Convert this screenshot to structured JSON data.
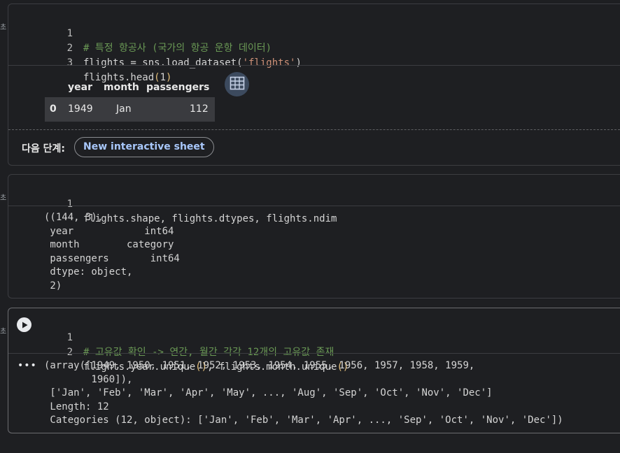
{
  "gutter_glyph": "초",
  "cell1": {
    "lines": [
      {
        "n": "1",
        "comment": "# 특정 항공사 (국가의 항공 운항 데이터)"
      },
      {
        "n": "2",
        "pre": "flights = sns.load_dataset(",
        "str": "'flights'",
        "post": ")"
      },
      {
        "n": "3",
        "pre": "flights.head",
        "lp": "(",
        "arg": "1",
        "rp": ")"
      }
    ],
    "df": {
      "columns": [
        "year",
        "month",
        "passengers"
      ],
      "rows": [
        {
          "index": "0",
          "year": "1949",
          "month": "Jan",
          "passengers": "112"
        }
      ]
    },
    "next_steps_label": "다음 단계:",
    "new_sheet_button": "New interactive sheet"
  },
  "cell2": {
    "lines": [
      {
        "n": "1",
        "code": "flights.shape, flights.dtypes, flights.ndim"
      }
    ],
    "output": "((144, 3),\n year            int64\n month        category\n passengers       int64\n dtype: object,\n 2)"
  },
  "cell3": {
    "lines": [
      {
        "n": "1",
        "comment": "# 고유값 확인 -> 연간, 월간 각각 12개의 고유값 존재"
      },
      {
        "n": "2",
        "pre": "flights.year.unique",
        "p1": "()",
        "mid": ", flights.month.unique",
        "p2": "()"
      }
    ],
    "output": "(array([1949, 1950, 1951, 1952, 1953, 1954, 1955, 1956, 1957, 1958, 1959,\n        1960]),\n ['Jan', 'Feb', 'Mar', 'Apr', 'May', ..., 'Aug', 'Sep', 'Oct', 'Nov', 'Dec']\n Length: 12\n Categories (12, object): ['Jan', 'Feb', 'Mar', 'Apr', ..., 'Sep', 'Oct', 'Nov', 'Dec'])"
  },
  "icons": {
    "run": "play-icon",
    "more": "more-horiz-icon",
    "table": "table-icon"
  },
  "colors": {
    "background": "#1e1f22",
    "comment": "#6a9955",
    "string": "#ce9178",
    "bracket": "#e5c07b",
    "accent": "#a8c7fa"
  }
}
